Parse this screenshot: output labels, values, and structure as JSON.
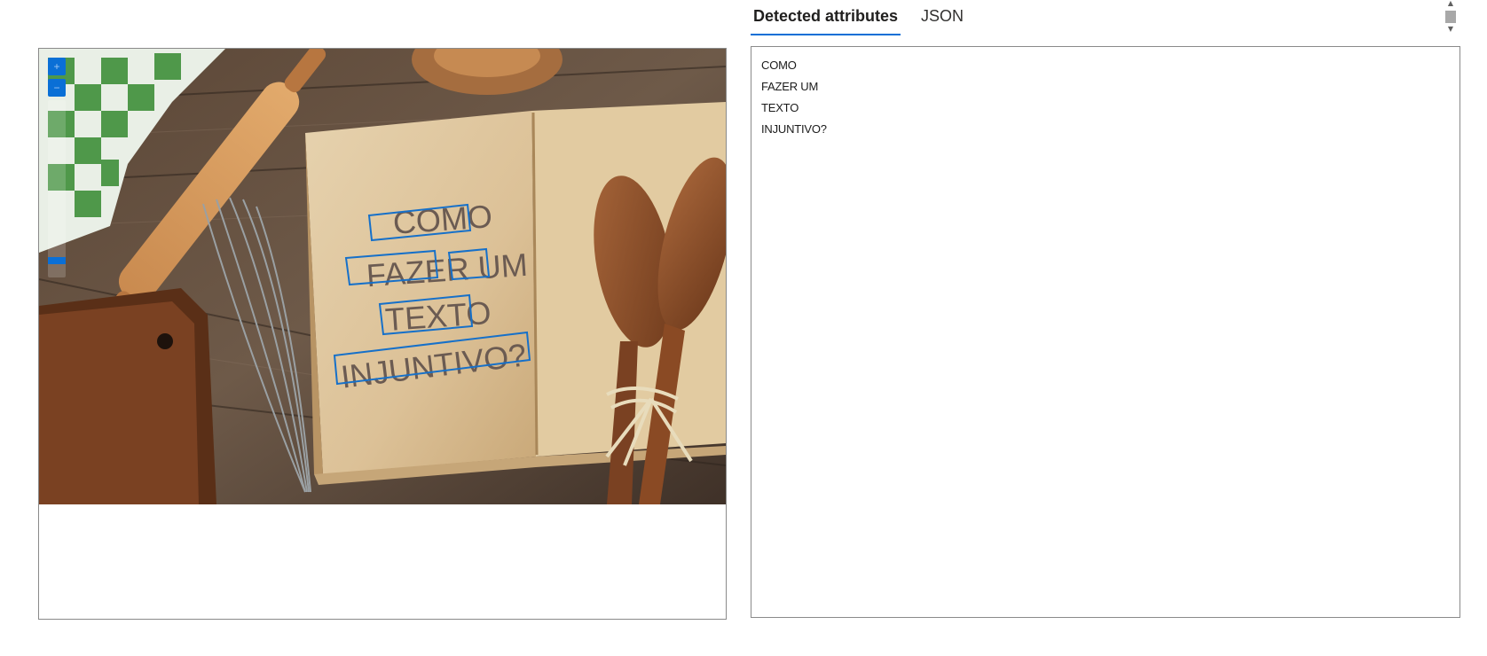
{
  "tabs": [
    {
      "label": "Detected attributes",
      "active": true
    },
    {
      "label": "JSON",
      "active": false
    }
  ],
  "zoom": {
    "plus_icon": "zoom-in-icon",
    "minus_icon": "zoom-out-icon",
    "plus_glyph": "+",
    "minus_glyph": "−",
    "level": 0.08
  },
  "image": {
    "printed_text": [
      "COMO",
      "FAZER UM",
      "TEXTO",
      "INJUNTIVO?"
    ]
  },
  "detected_lines": [
    {
      "text": "COMO"
    },
    {
      "text": "FAZER UM"
    },
    {
      "text": "TEXTO"
    },
    {
      "text": "INJUNTIVO?"
    }
  ],
  "colors": {
    "accent": "#0a6fd6",
    "bounding_box": "#1670c9",
    "border": "#8a8a8a"
  }
}
